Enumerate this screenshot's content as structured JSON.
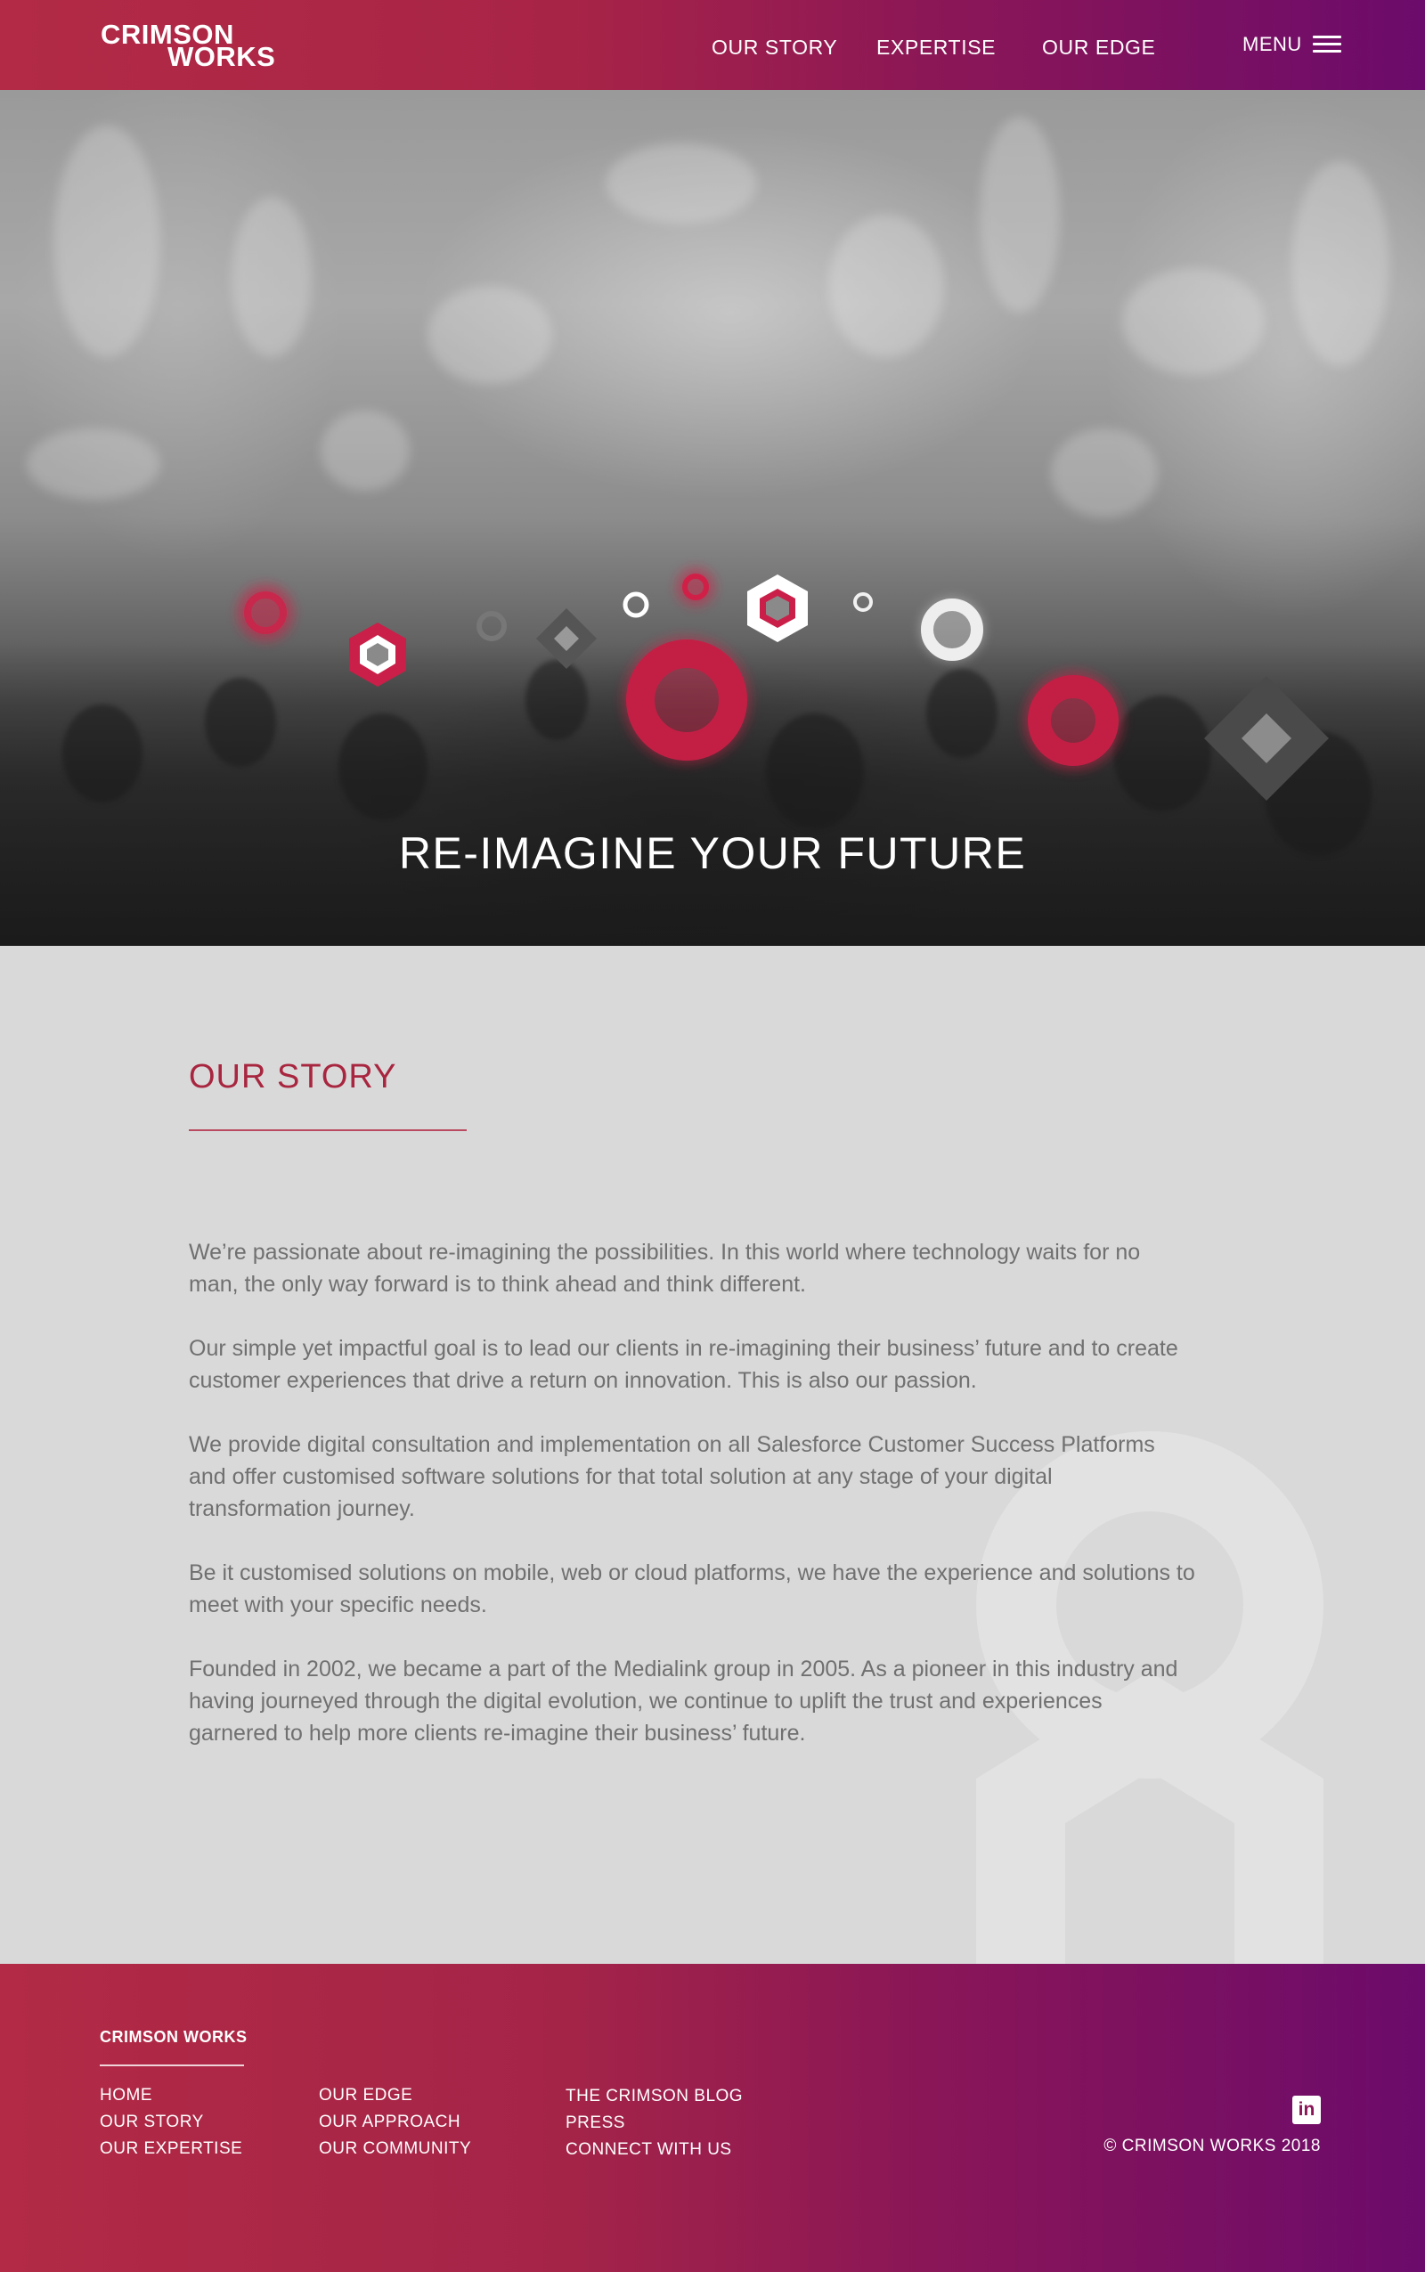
{
  "brand": {
    "line1": "CRIMSON",
    "line2": "WORKS"
  },
  "nav": {
    "items": [
      "OUR STORY",
      "EXPERTISE",
      "OUR EDGE"
    ],
    "menu_label": "MENU"
  },
  "hero": {
    "title": "RE-IMAGINE YOUR FUTURE"
  },
  "story": {
    "title": "OUR STORY",
    "paragraphs": [
      "We’re passionate about re-imagining the possibilities. In this world where technology waits for no man, the only way forward is to think ahead and think different.",
      "Our simple yet impactful goal is to lead our clients in re-imagining their business’ future and to create customer experiences that drive a return on innovation. This is also our passion.",
      "We provide digital consultation and implementation on all Salesforce Customer Success Platforms and offer customised software solutions for that total solution at any stage of your digital transformation journey.",
      "Be it customised solutions on mobile, web or cloud platforms, we have the experience and solutions to meet with your specific needs.",
      "Founded in 2002, we became a part of the Medialink group in 2005. As a pioneer in this industry and having journeyed through the digital evolution, we continue to uplift the trust and experiences garnered to help more clients re-imagine their business’ future."
    ]
  },
  "footer": {
    "brand": "CRIMSON WORKS",
    "col1": [
      "HOME",
      "OUR STORY",
      "OUR EXPERTISE"
    ],
    "col2": [
      "OUR EDGE",
      "OUR APPROACH",
      "OUR COMMUNITY"
    ],
    "col3": [
      "THE CRIMSON BLOG",
      "PRESS",
      "CONNECT WITH US"
    ],
    "social_icon": "linkedin-icon",
    "social_glyph": "in",
    "copyright": "© CRIMSON WORKS 2018"
  },
  "colors": {
    "crimson": "#a8263f",
    "purple": "#6c0b6b",
    "background": "#d9d9d9",
    "hero_accent": "#d02048"
  }
}
